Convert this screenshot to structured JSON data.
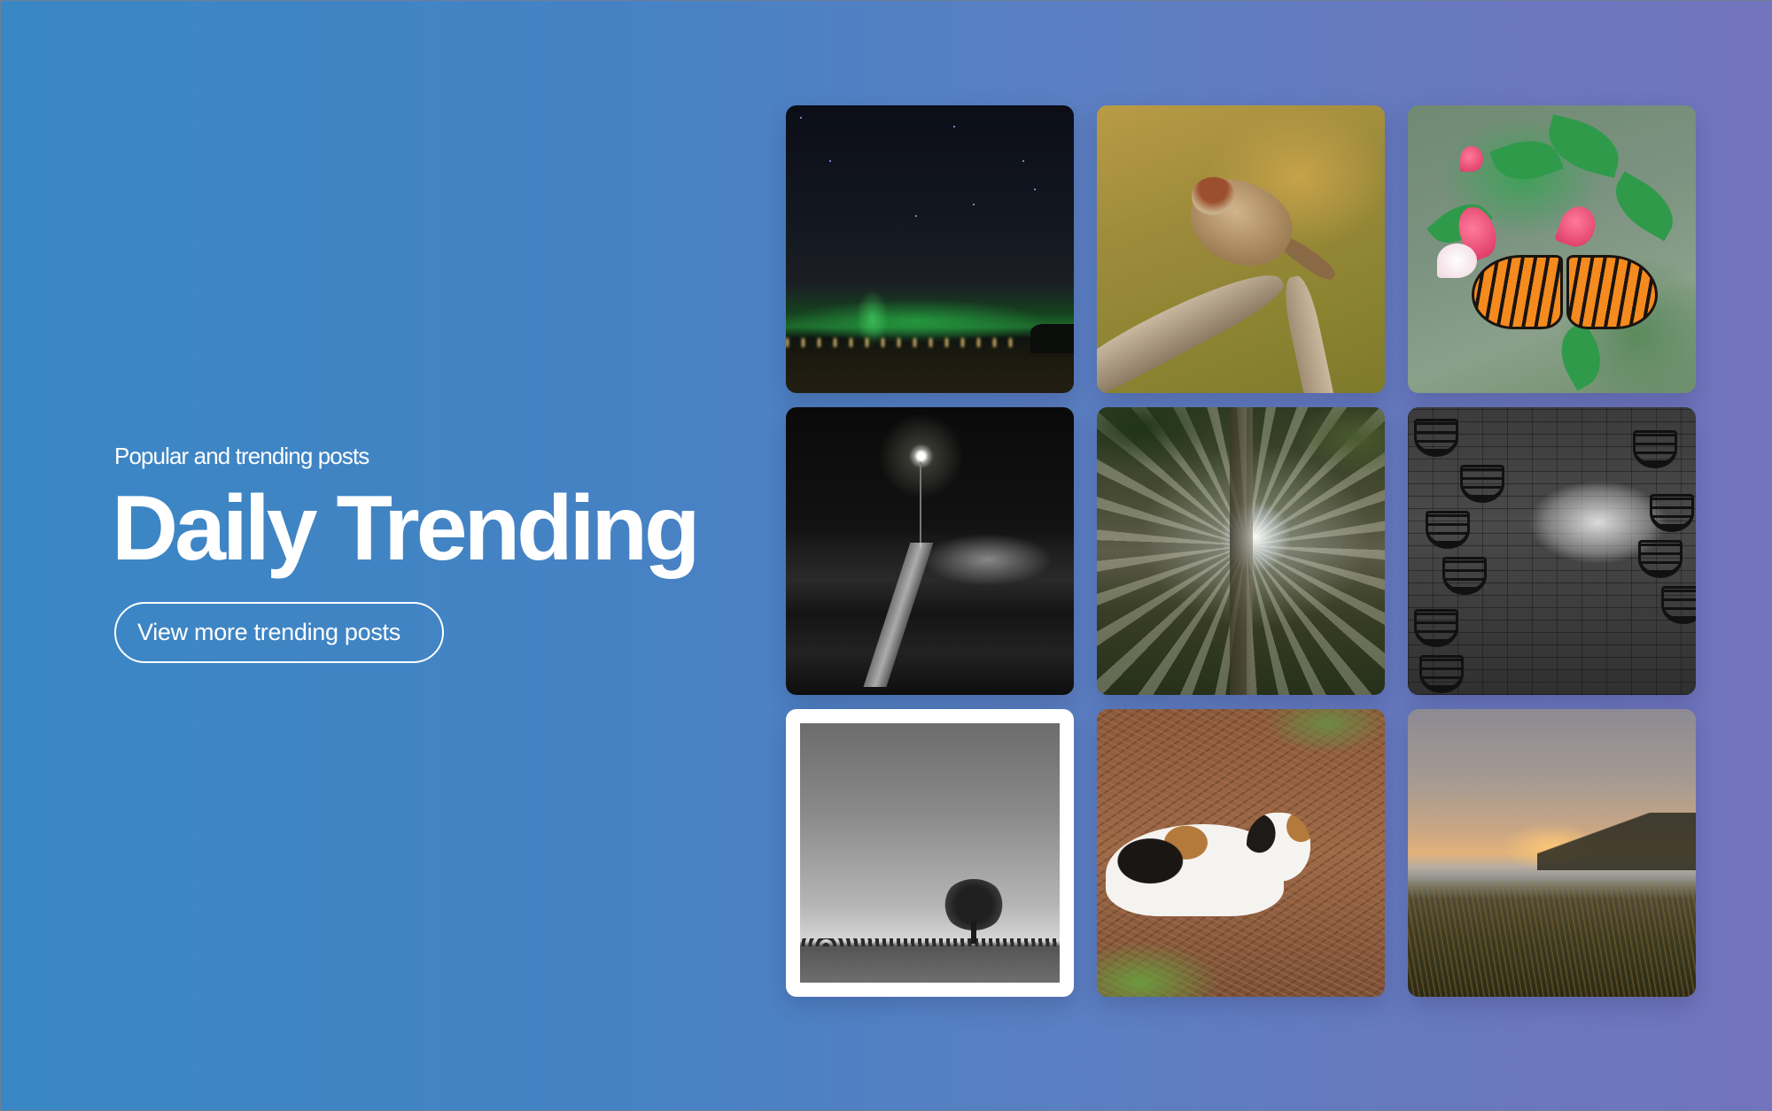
{
  "hero": {
    "subtitle": "Popular and trending posts",
    "title": "Daily Trending",
    "cta_label": "View more trending posts"
  },
  "colors": {
    "background_start": "#3a87c5",
    "background_end": "#7274bd",
    "text": "#ffffff"
  },
  "gallery": {
    "tiles": [
      {
        "subject": "Aurora over field at night",
        "highlighted": false
      },
      {
        "subject": "Sparrow on branch holding grass",
        "highlighted": false
      },
      {
        "subject": "Orange butterfly on pink fuchsia",
        "highlighted": false
      },
      {
        "subject": "Pier railing and lamp at night",
        "highlighted": false
      },
      {
        "subject": "Sunbeams through forest trees",
        "highlighted": false
      },
      {
        "subject": "Empty chairs on brick patio",
        "highlighted": false
      },
      {
        "subject": "Lone tree on horizon in black and white",
        "highlighted": true
      },
      {
        "subject": "Calico cat lying on pine needles",
        "highlighted": false
      },
      {
        "subject": "Misty field at sunrise",
        "highlighted": false
      }
    ]
  }
}
